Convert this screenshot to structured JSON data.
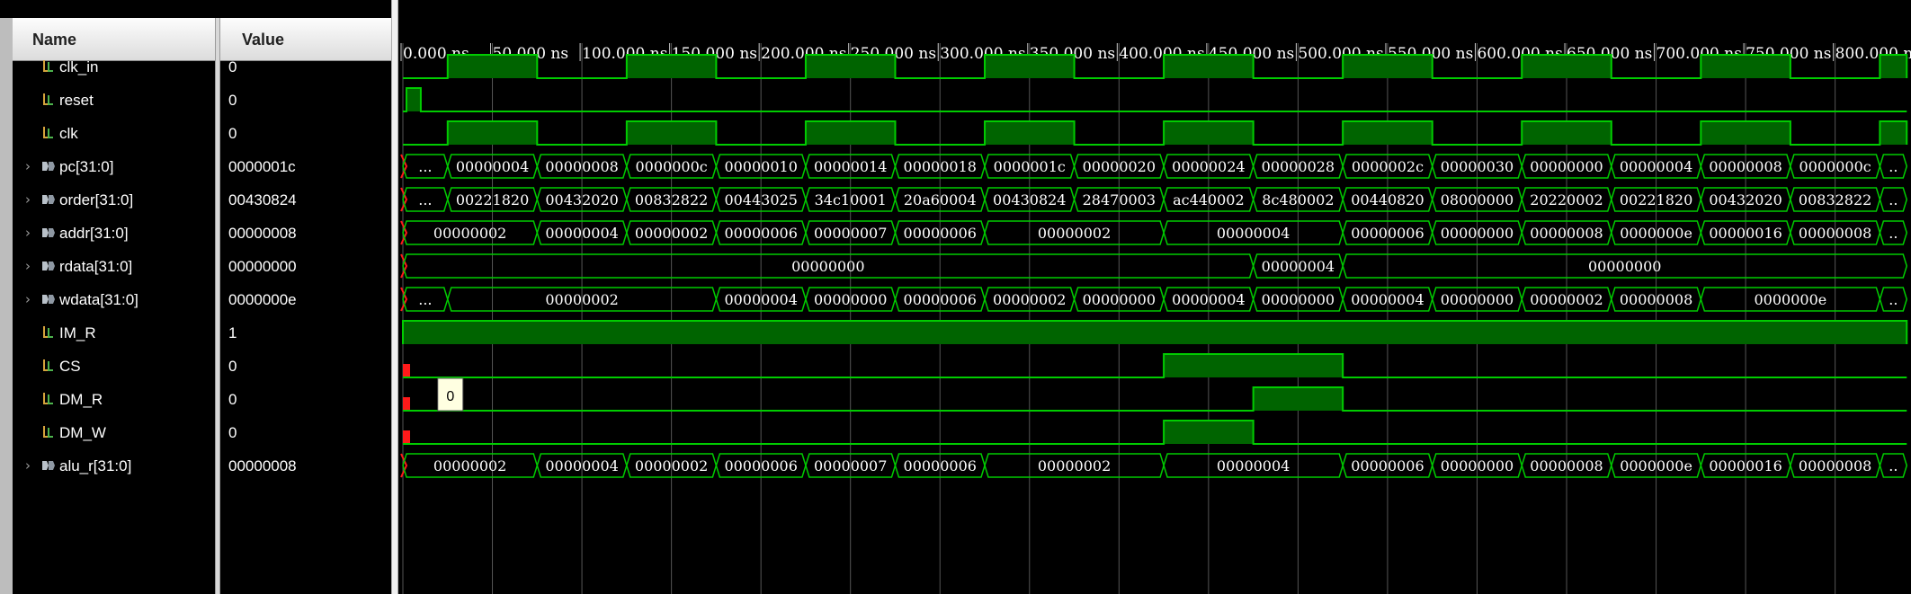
{
  "columns": {
    "name_header": "Name",
    "value_header": "Value"
  },
  "colors": {
    "wave": "#00cc00",
    "fill": "#006400",
    "bus": "#00cc00",
    "x_state": "#ff1a1a",
    "time_text": "#ffffff",
    "grid": "#555555"
  },
  "time_axis": {
    "unit": "ns",
    "labels": [
      "0.000 ns",
      "50.000 ns",
      "100.000 ns",
      "150.000 ns",
      "200.000 ns",
      "250.000 ns",
      "300.000 ns",
      "350.000 ns",
      "400.000 ns",
      "450.000 ns",
      "500.000 ns",
      "550.000 ns",
      "600.000 ns",
      "650.000 ns",
      "700.000 ns",
      "750.000 ns",
      "800.000 ns"
    ]
  },
  "signals": [
    {
      "name": "clk_in",
      "value": "0",
      "kind": "bit",
      "icon": "bit-signal-icon",
      "expandable": false,
      "clock": true,
      "period_ns": 100,
      "high_first_ns": 25
    },
    {
      "name": "reset",
      "value": "0",
      "kind": "bit",
      "icon": "bit-signal-icon",
      "expandable": false,
      "pulses": [
        [
          2,
          10
        ]
      ]
    },
    {
      "name": "clk",
      "value": "0",
      "kind": "bit",
      "icon": "bit-signal-icon",
      "expandable": false,
      "clock": true,
      "period_ns": 100,
      "high_first_ns": 25
    },
    {
      "name": "pc[31:0]",
      "value": "0000001c",
      "kind": "bus",
      "icon": "bus-signal-icon",
      "expandable": true,
      "segments": [
        {
          "t0": 0,
          "t1": 25,
          "label": "..."
        },
        {
          "t0": 25,
          "t1": 75,
          "label": "00000004"
        },
        {
          "t0": 75,
          "t1": 125,
          "label": "00000008"
        },
        {
          "t0": 125,
          "t1": 175,
          "label": "0000000c"
        },
        {
          "t0": 175,
          "t1": 225,
          "label": "00000010"
        },
        {
          "t0": 225,
          "t1": 275,
          "label": "00000014"
        },
        {
          "t0": 275,
          "t1": 325,
          "label": "00000018"
        },
        {
          "t0": 325,
          "t1": 375,
          "label": "0000001c"
        },
        {
          "t0": 375,
          "t1": 425,
          "label": "00000020"
        },
        {
          "t0": 425,
          "t1": 475,
          "label": "00000024"
        },
        {
          "t0": 475,
          "t1": 525,
          "label": "00000028"
        },
        {
          "t0": 525,
          "t1": 575,
          "label": "0000002c"
        },
        {
          "t0": 575,
          "t1": 625,
          "label": "00000030"
        },
        {
          "t0": 625,
          "t1": 675,
          "label": "00000000"
        },
        {
          "t0": 675,
          "t1": 725,
          "label": "00000004"
        },
        {
          "t0": 725,
          "t1": 775,
          "label": "00000008"
        },
        {
          "t0": 775,
          "t1": 825,
          "label": "0000000c"
        },
        {
          "t0": 825,
          "t1": 840,
          "label": ".."
        }
      ]
    },
    {
      "name": "order[31:0]",
      "value": "00430824",
      "kind": "bus",
      "icon": "bus-signal-icon",
      "expandable": true,
      "segments": [
        {
          "t0": 0,
          "t1": 25,
          "label": "..."
        },
        {
          "t0": 25,
          "t1": 75,
          "label": "00221820"
        },
        {
          "t0": 75,
          "t1": 125,
          "label": "00432020"
        },
        {
          "t0": 125,
          "t1": 175,
          "label": "00832822"
        },
        {
          "t0": 175,
          "t1": 225,
          "label": "00443025"
        },
        {
          "t0": 225,
          "t1": 275,
          "label": "34c10001"
        },
        {
          "t0": 275,
          "t1": 325,
          "label": "20a60004"
        },
        {
          "t0": 325,
          "t1": 375,
          "label": "00430824"
        },
        {
          "t0": 375,
          "t1": 425,
          "label": "28470003"
        },
        {
          "t0": 425,
          "t1": 475,
          "label": "ac440002"
        },
        {
          "t0": 475,
          "t1": 525,
          "label": "8c480002"
        },
        {
          "t0": 525,
          "t1": 575,
          "label": "00440820"
        },
        {
          "t0": 575,
          "t1": 625,
          "label": "08000000"
        },
        {
          "t0": 625,
          "t1": 675,
          "label": "20220002"
        },
        {
          "t0": 675,
          "t1": 725,
          "label": "00221820"
        },
        {
          "t0": 725,
          "t1": 775,
          "label": "00432020"
        },
        {
          "t0": 775,
          "t1": 825,
          "label": "00832822"
        },
        {
          "t0": 825,
          "t1": 840,
          "label": ".."
        }
      ]
    },
    {
      "name": "addr[31:0]",
      "value": "00000008",
      "kind": "bus",
      "icon": "bus-signal-icon",
      "expandable": true,
      "segments": [
        {
          "t0": 0,
          "t1": 75,
          "label": "00000002"
        },
        {
          "t0": 75,
          "t1": 125,
          "label": "00000004"
        },
        {
          "t0": 125,
          "t1": 175,
          "label": "00000002"
        },
        {
          "t0": 175,
          "t1": 225,
          "label": "00000006"
        },
        {
          "t0": 225,
          "t1": 275,
          "label": "00000007"
        },
        {
          "t0": 275,
          "t1": 325,
          "label": "00000006"
        },
        {
          "t0": 325,
          "t1": 425,
          "label": "00000002"
        },
        {
          "t0": 425,
          "t1": 525,
          "label": "00000004"
        },
        {
          "t0": 525,
          "t1": 575,
          "label": "00000006"
        },
        {
          "t0": 575,
          "t1": 625,
          "label": "00000000"
        },
        {
          "t0": 625,
          "t1": 675,
          "label": "00000008"
        },
        {
          "t0": 675,
          "t1": 725,
          "label": "0000000e"
        },
        {
          "t0": 725,
          "t1": 775,
          "label": "00000016"
        },
        {
          "t0": 775,
          "t1": 825,
          "label": "00000008"
        },
        {
          "t0": 825,
          "t1": 840,
          "label": ".."
        }
      ]
    },
    {
      "name": "rdata[31:0]",
      "value": "00000000",
      "kind": "bus",
      "icon": "bus-signal-icon",
      "expandable": true,
      "segments": [
        {
          "t0": 0,
          "t1": 475,
          "label": "00000000"
        },
        {
          "t0": 475,
          "t1": 525,
          "label": "00000004"
        },
        {
          "t0": 525,
          "t1": 840,
          "label": "00000000"
        }
      ]
    },
    {
      "name": "wdata[31:0]",
      "value": "0000000e",
      "kind": "bus",
      "icon": "bus-signal-icon",
      "expandable": true,
      "segments": [
        {
          "t0": 0,
          "t1": 25,
          "label": "..."
        },
        {
          "t0": 25,
          "t1": 175,
          "label": "00000002"
        },
        {
          "t0": 175,
          "t1": 225,
          "label": "00000004"
        },
        {
          "t0": 225,
          "t1": 275,
          "label": "00000000"
        },
        {
          "t0": 275,
          "t1": 325,
          "label": "00000006"
        },
        {
          "t0": 325,
          "t1": 375,
          "label": "00000002"
        },
        {
          "t0": 375,
          "t1": 425,
          "label": "00000000"
        },
        {
          "t0": 425,
          "t1": 475,
          "label": "00000004"
        },
        {
          "t0": 475,
          "t1": 525,
          "label": "00000000"
        },
        {
          "t0": 525,
          "t1": 575,
          "label": "00000004"
        },
        {
          "t0": 575,
          "t1": 625,
          "label": "00000000"
        },
        {
          "t0": 625,
          "t1": 675,
          "label": "00000002"
        },
        {
          "t0": 675,
          "t1": 725,
          "label": "00000008"
        },
        {
          "t0": 725,
          "t1": 825,
          "label": "0000000e"
        },
        {
          "t0": 825,
          "t1": 840,
          "label": ".."
        }
      ]
    },
    {
      "name": "IM_R",
      "value": "1",
      "kind": "bit",
      "icon": "bit-signal-icon",
      "expandable": false,
      "pulses": [
        [
          0,
          840
        ]
      ]
    },
    {
      "name": "CS",
      "value": "0",
      "kind": "bit",
      "icon": "bit-signal-icon",
      "expandable": false,
      "pulses": [
        [
          425,
          525
        ]
      ],
      "x_start": true
    },
    {
      "name": "DM_R",
      "value": "0",
      "kind": "bit",
      "icon": "bit-signal-icon",
      "expandable": false,
      "pulses": [
        [
          475,
          525
        ]
      ],
      "x_start": true
    },
    {
      "name": "DM_W",
      "value": "0",
      "kind": "bit",
      "icon": "bit-signal-icon",
      "expandable": false,
      "pulses": [
        [
          425,
          475
        ]
      ],
      "x_start": true
    },
    {
      "name": "alu_r[31:0]",
      "value": "00000008",
      "kind": "bus",
      "icon": "bus-signal-icon",
      "expandable": true,
      "segments": [
        {
          "t0": 0,
          "t1": 75,
          "label": "00000002"
        },
        {
          "t0": 75,
          "t1": 125,
          "label": "00000004"
        },
        {
          "t0": 125,
          "t1": 175,
          "label": "00000002"
        },
        {
          "t0": 175,
          "t1": 225,
          "label": "00000006"
        },
        {
          "t0": 225,
          "t1": 275,
          "label": "00000007"
        },
        {
          "t0": 275,
          "t1": 325,
          "label": "00000006"
        },
        {
          "t0": 325,
          "t1": 425,
          "label": "00000002"
        },
        {
          "t0": 425,
          "t1": 525,
          "label": "00000004"
        },
        {
          "t0": 525,
          "t1": 575,
          "label": "00000006"
        },
        {
          "t0": 575,
          "t1": 625,
          "label": "00000000"
        },
        {
          "t0": 625,
          "t1": 675,
          "label": "00000008"
        },
        {
          "t0": 675,
          "t1": 725,
          "label": "0000000e"
        },
        {
          "t0": 725,
          "t1": 775,
          "label": "00000016"
        },
        {
          "t0": 775,
          "t1": 825,
          "label": "00000008"
        },
        {
          "t0": 825,
          "t1": 840,
          "label": ".."
        }
      ]
    }
  ],
  "tooltip": {
    "text": "0",
    "signal": "DM_R",
    "time_ns": 25
  }
}
